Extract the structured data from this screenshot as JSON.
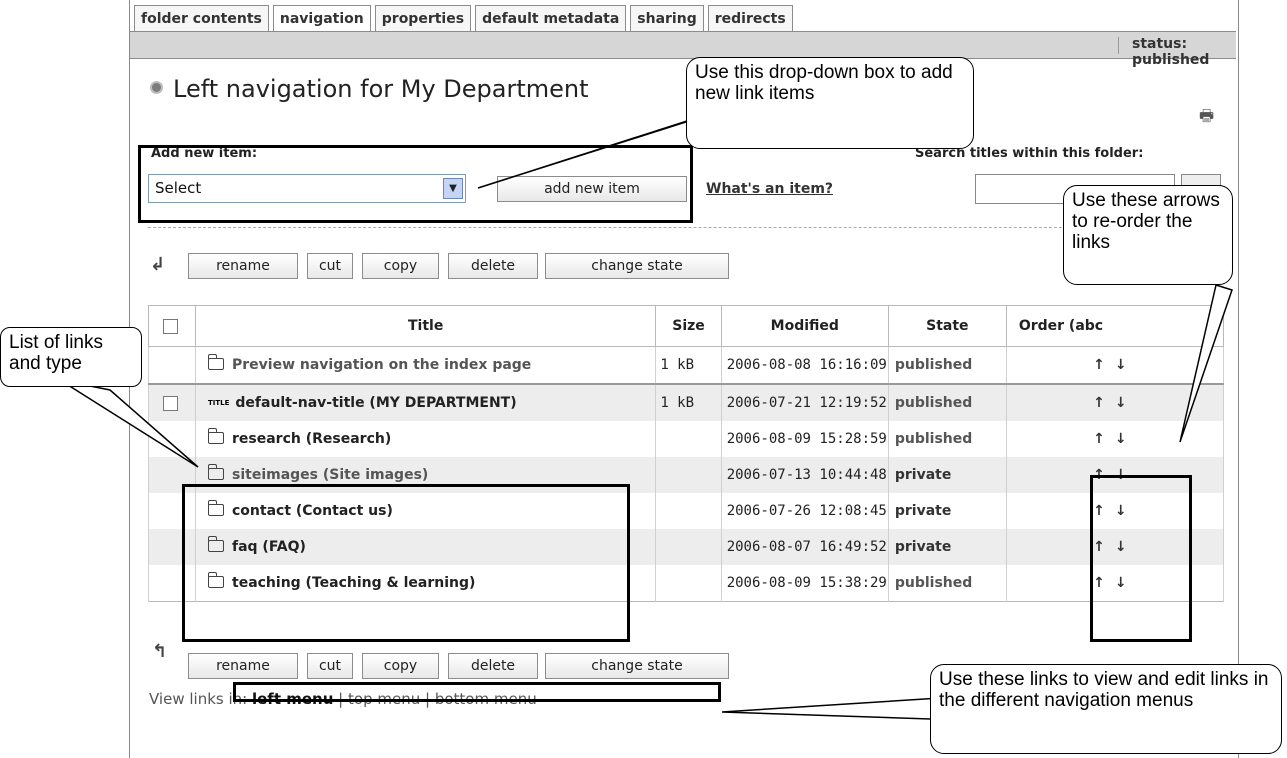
{
  "tabs": [
    "folder contents",
    "navigation",
    "properties",
    "default metadata",
    "sharing",
    "redirects"
  ],
  "status": {
    "text": "status: published"
  },
  "page_title": "Left navigation for My Department",
  "add_item": {
    "label": "Add new item:",
    "select_value": "Select",
    "button": "add new item",
    "help_link": "What's an item?"
  },
  "search": {
    "label": "Search titles within this folder:",
    "value": ""
  },
  "actions": {
    "rename": "rename",
    "cut": "cut",
    "copy": "copy",
    "delete": "delete",
    "change_state": "change state"
  },
  "table": {
    "headers": {
      "title": "Title",
      "size": "Size",
      "modified": "Modified",
      "state": "State",
      "order": "Order (abc"
    },
    "rows": [
      {
        "title": "Preview navigation on the index page",
        "size": "1 kB",
        "modified": "2006-08-08 16:16:09",
        "state": "published",
        "order_up": "↑",
        "order_down": "↓"
      },
      {
        "title": "default-nav-title (MY DEPARTMENT)",
        "size": "1 kB",
        "modified": "2006-07-21 12:19:52",
        "state": "published",
        "order_up": "↑",
        "order_down": "↓"
      },
      {
        "title": "research (Research)",
        "size": "",
        "modified": "2006-08-09 15:28:59",
        "state": "published",
        "order_up": "↑",
        "order_down": "↓"
      },
      {
        "title": "siteimages (Site images)",
        "size": "",
        "modified": "2006-07-13 10:44:48",
        "state": "private",
        "order_up": "↑",
        "order_down": "↓"
      },
      {
        "title": "contact (Contact us)",
        "size": "",
        "modified": "2006-07-26 12:08:45",
        "state": "private",
        "order_up": "↑",
        "order_down": "↓"
      },
      {
        "title": "faq (FAQ)",
        "size": "",
        "modified": "2006-08-07 16:49:52",
        "state": "private",
        "order_up": "↑",
        "order_down": "↓"
      },
      {
        "title": "teaching (Teaching & learning)",
        "size": "",
        "modified": "2006-08-09 15:38:29",
        "state": "published",
        "order_up": "↑",
        "order_down": "↓"
      }
    ]
  },
  "view_links": {
    "prefix": "View links in:",
    "left": "left menu",
    "sep": "|",
    "top": "top menu",
    "bottom": "bottom menu"
  },
  "title_icon_text": "TITLE",
  "callouts": {
    "dropdown": "Use this drop-down box to add new link items",
    "arrows": "Use these arrows to re-order the links",
    "list": "List of links and type",
    "menus": "Use these links to view and edit links in the different navigation menus"
  }
}
